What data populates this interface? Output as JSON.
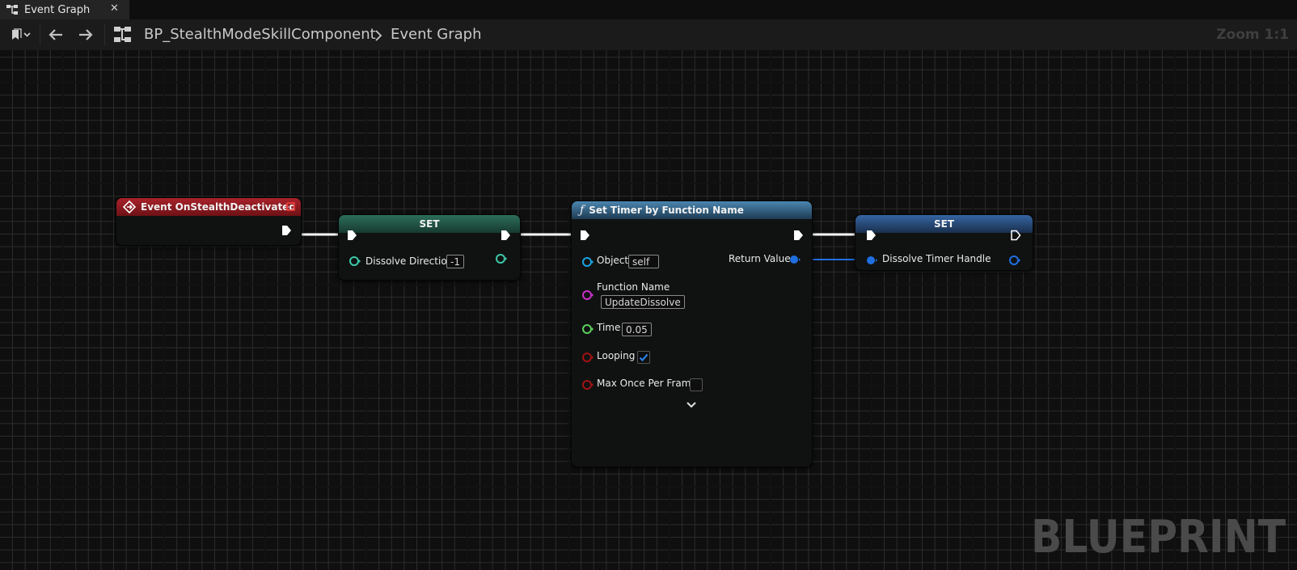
{
  "tab": {
    "title": "Event Graph",
    "close": "✕"
  },
  "toolbar": {
    "breadcrumb_blueprint": "BP_StealthModeSkillComponent",
    "breadcrumb_graph": "Event Graph",
    "zoom": "Zoom 1:1"
  },
  "watermark": "BLUEPRINT",
  "nodes": {
    "event": {
      "title": "Event OnStealthDeactivated",
      "header_color": "#8a1c1c"
    },
    "set1": {
      "title": "SET",
      "variable": "Dissolve Direction",
      "value": "-1",
      "header_color": "#2b6b55"
    },
    "timer": {
      "title": "Set Timer by Function Name",
      "header_color": "#3b6f93",
      "object_label": "Object",
      "object_value": "self",
      "function_label": "Function Name",
      "function_value": "UpdateDissolve",
      "time_label": "Time",
      "time_value": "0.05",
      "looping_label": "Looping",
      "looping": true,
      "maxonce_label": "Max Once Per Frame",
      "maxonce": false,
      "return_label": "Return Value"
    },
    "set2": {
      "title": "SET",
      "variable": "Dissolve Timer Handle",
      "header_color": "#2f5f9a"
    }
  },
  "colors": {
    "exec": "#ffffff",
    "float_pin": "#3dc8a8",
    "object_pin": "#1aa3e0",
    "name_pin": "#c832c8",
    "time_pin": "#5cd15c",
    "bool_pin": "#a01212",
    "handle_pin": "#1f6fe0"
  }
}
